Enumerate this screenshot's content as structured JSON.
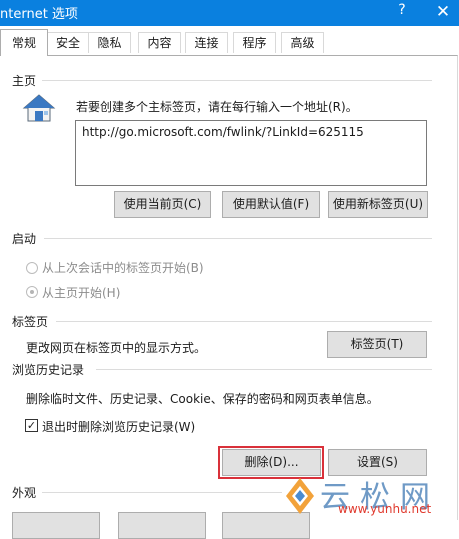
{
  "window": {
    "title": "nternet 选项",
    "help_glyph": "?",
    "close_glyph": "✕"
  },
  "tabs": [
    "常规",
    "安全",
    "隐私",
    "内容",
    "连接",
    "程序",
    "高级"
  ],
  "homepage": {
    "section": "主页",
    "description": "若要创建多个主标签页，请在每行输入一个地址(R)。",
    "url": "http://go.microsoft.com/fwlink/?LinkId=625115",
    "buttons": [
      "使用当前页(C)",
      "使用默认值(F)",
      "使用新标签页(U)"
    ]
  },
  "startup": {
    "section": "启动",
    "options": [
      "从上次会话中的标签页开始(B)",
      "从主页开始(H)"
    ],
    "selected_index": 1
  },
  "tabs_section": {
    "section": "标签页",
    "description": "更改网页在标签页中的显示方式。",
    "button": "标签页(T)"
  },
  "history": {
    "section": "浏览历史记录",
    "description": "删除临时文件、历史记录、Cookie、保存的密码和网页表单信息。",
    "checkbox_label": "退出时删除浏览历史记录(W)",
    "checkbox_checked": true,
    "buttons": [
      "删除(D)...",
      "设置(S)"
    ]
  },
  "appearance": {
    "section": "外观"
  },
  "watermark": {
    "chars": "云松网",
    "url": "www.yunhu.net"
  }
}
